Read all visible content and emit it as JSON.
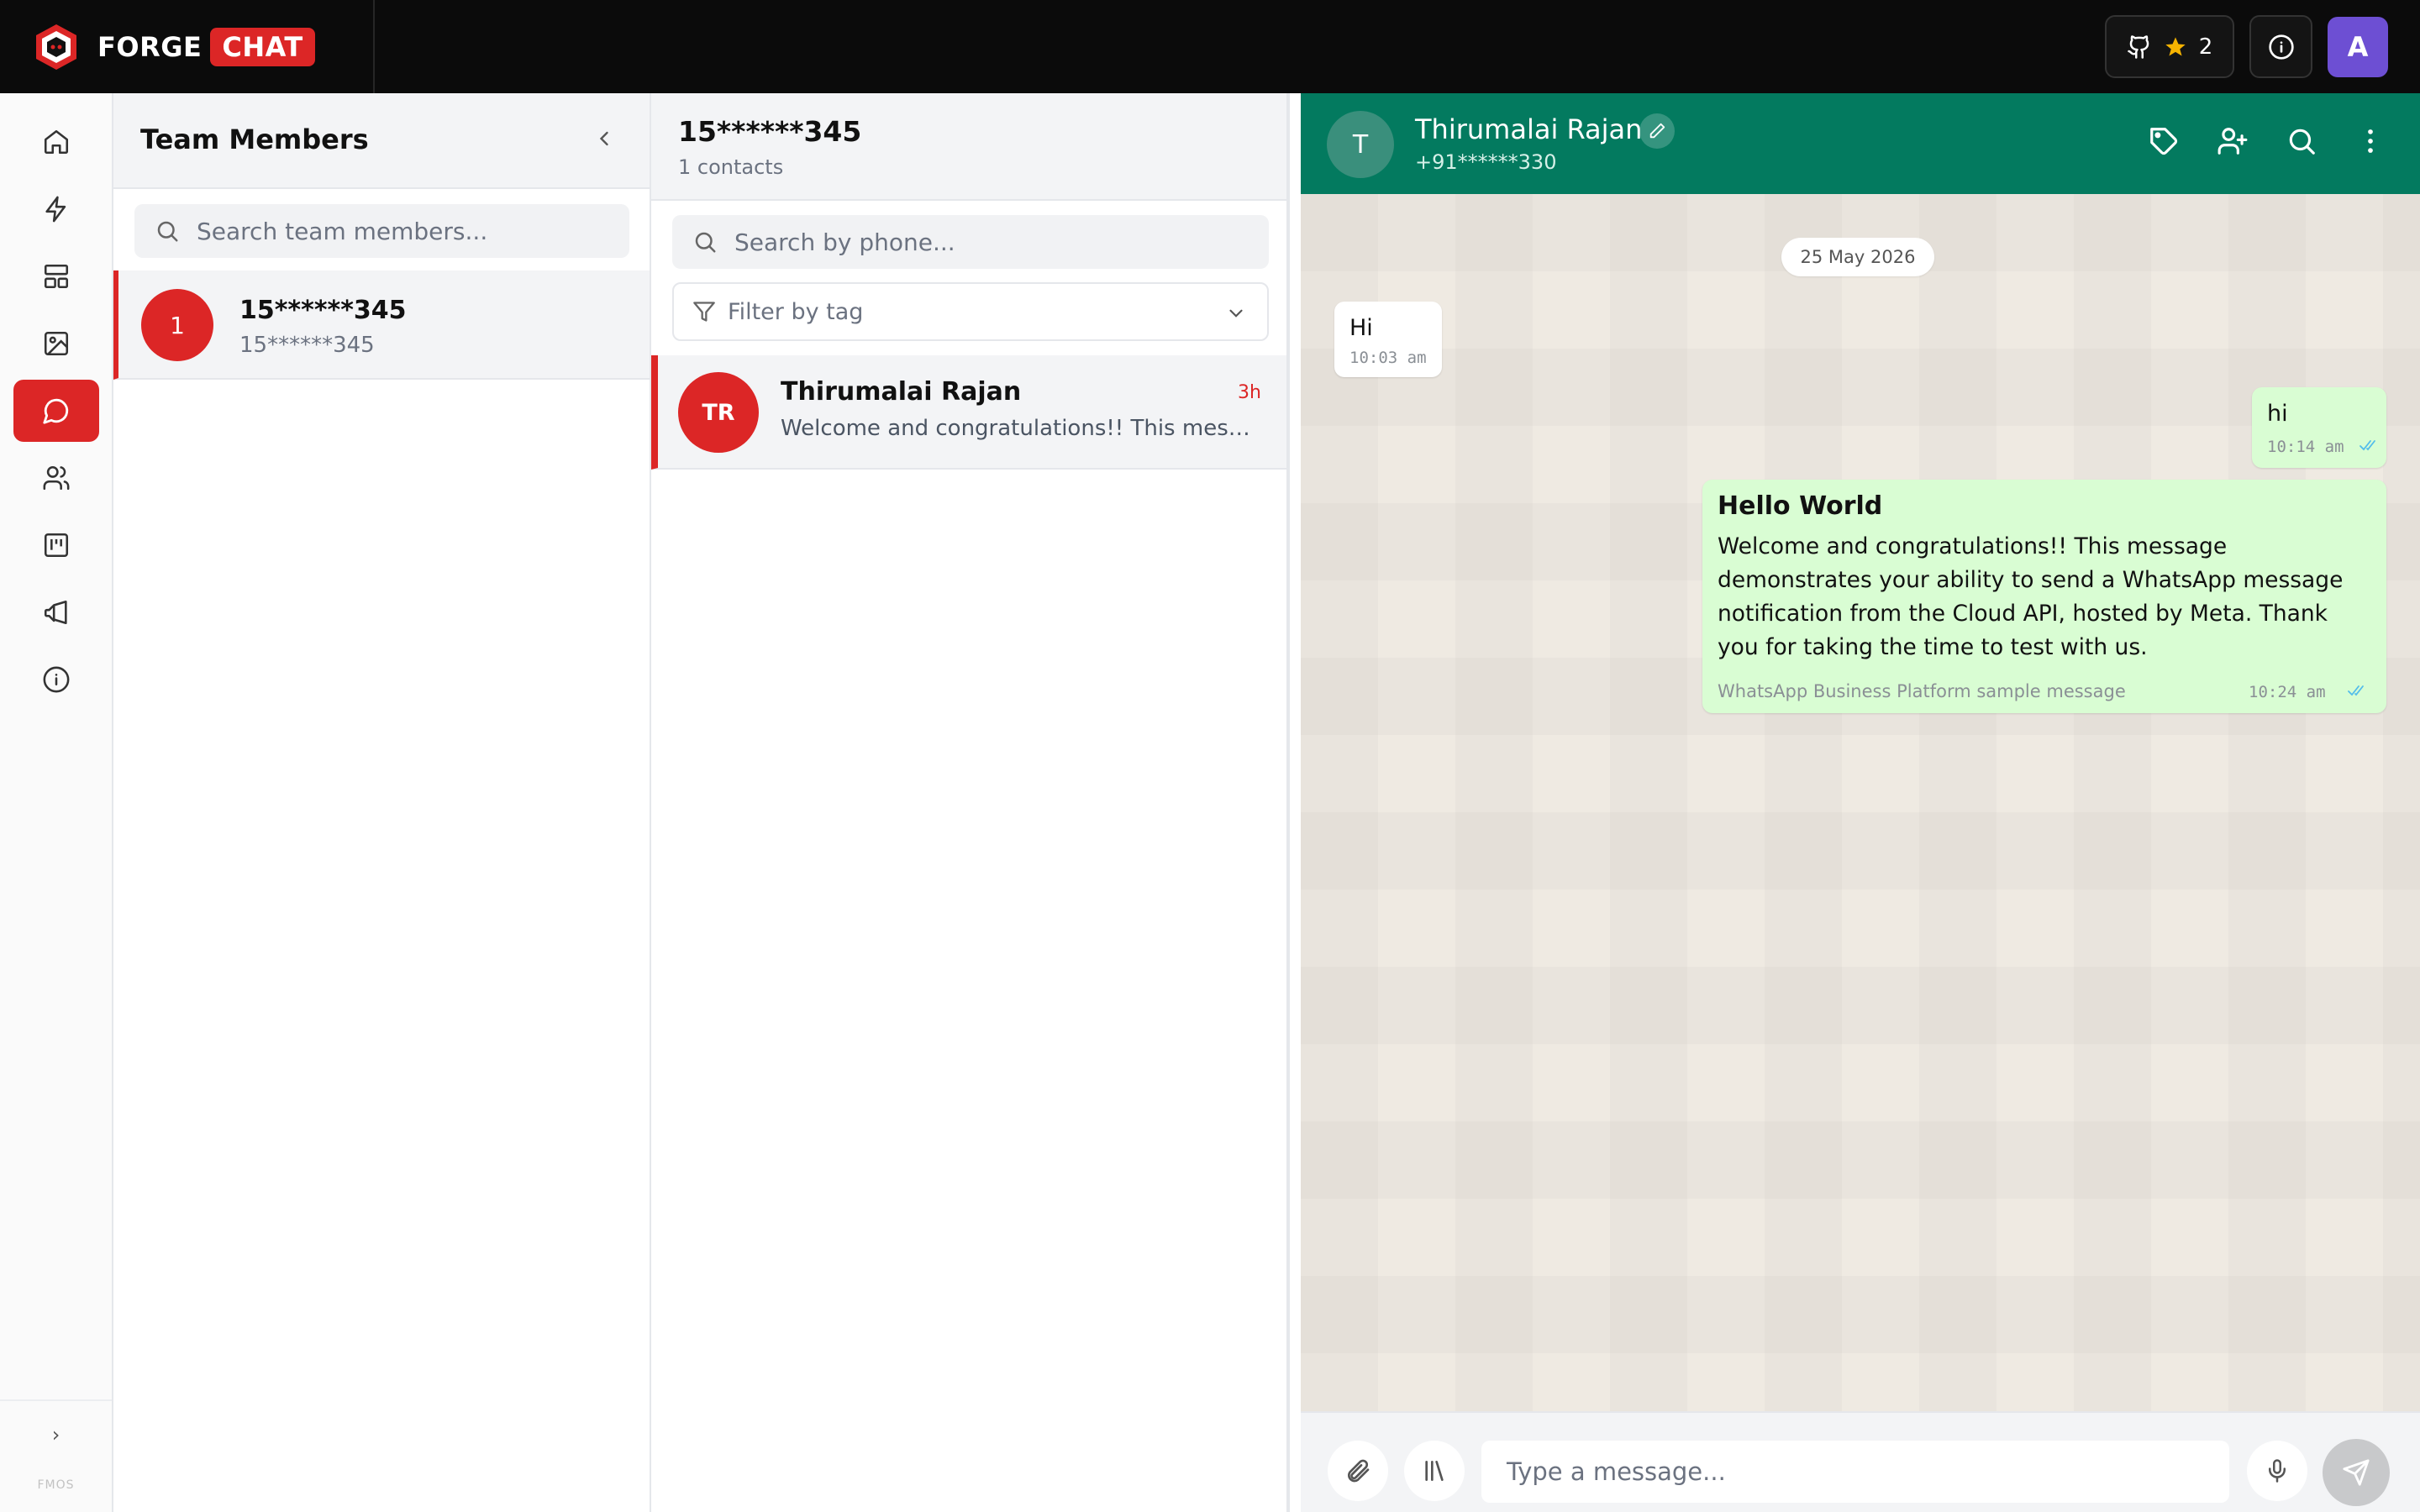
{
  "brand": {
    "name_left": "FORGE",
    "name_right": "CHAT"
  },
  "topbar": {
    "star_count": "2",
    "avatar_letter": "A"
  },
  "rail": {
    "fmos_label": "FMOS",
    "expand_glyph": "›"
  },
  "team": {
    "title": "Team Members",
    "search_placeholder": "Search team members...",
    "members": [
      {
        "avatar": "1",
        "name": "15******345",
        "sub": "15******345"
      }
    ]
  },
  "contacts": {
    "title": "15******345",
    "count_text": "1 contacts",
    "search_placeholder": "Search by phone...",
    "filter_placeholder": "Filter by tag",
    "items": [
      {
        "initials": "TR",
        "name": "Thirumalai Rajan",
        "time": "3h",
        "preview": "Welcome and congratulations!! This message demonstrates your ability to send a WhatsApp message notification from the Cloud API, hosted by Meta."
      }
    ]
  },
  "chat": {
    "avatar_letter": "T",
    "contact_name": "Thirumalai Rajan",
    "contact_phone": "+91******330",
    "date_chip": "25 May 2026",
    "messages": [
      {
        "direction": "in",
        "text": "Hi",
        "time": "10:03 am"
      },
      {
        "direction": "out",
        "text": "hi",
        "time": "10:14 am"
      },
      {
        "direction": "out",
        "title": "Hello World",
        "text": "Welcome and congratulations!! This message demonstrates your ability to send a WhatsApp message notification from the Cloud API, hosted by Meta. Thank you for taking the time to test with us.",
        "footer": "WhatsApp Business Platform sample message",
        "time": "10:24 am"
      }
    ],
    "composer_placeholder": "Type a message..."
  },
  "colors": {
    "accent": "#dc2626",
    "chat_header": "#037a5f",
    "out_bubble": "#d9fdd3",
    "chat_bg": "#efeae2"
  }
}
